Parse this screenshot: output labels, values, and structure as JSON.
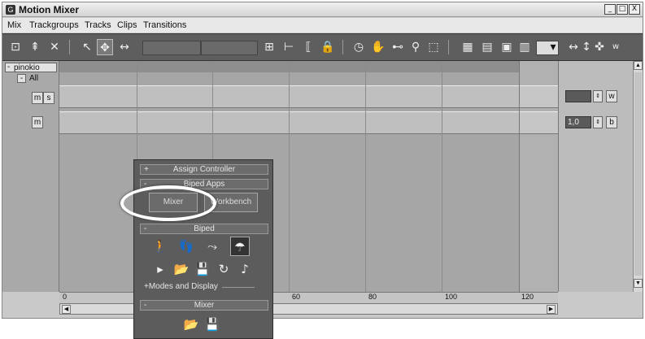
{
  "window": {
    "title": "Motion Mixer",
    "controls": [
      "_",
      "□",
      "X"
    ]
  },
  "menu": [
    "Mix",
    "Trackgroups",
    "Tracks",
    "Clips",
    "Transitions"
  ],
  "toolbar": {
    "icons": [
      "add-trackgroup-icon",
      "add-track-icon",
      "delete-icon",
      "select-icon",
      "move-icon",
      "slide-icon",
      "fit-icon",
      "timeline-icon",
      "bracket-icon",
      "lock-icon",
      "clock-icon",
      "pan-hand-icon",
      "zoom-extents-icon",
      "zoom-icon",
      "zoom-region-icon",
      "filter-icon",
      "filter2-icon",
      "mix-icon",
      "preview-icon",
      "dropdown-icon",
      "arrows-icon",
      "w-icon"
    ],
    "w_label": "w"
  },
  "tree": {
    "root": "pinokio",
    "group": "All",
    "track1_buttons": [
      "m",
      "s"
    ],
    "track2_buttons": [
      "m"
    ]
  },
  "right_controls": {
    "weight_label": "w",
    "value": "1,0",
    "b_label": "b"
  },
  "ruler": {
    "ticks": [
      "0",
      "60",
      "80",
      "100",
      "120"
    ]
  },
  "rollout": {
    "assign_controller": {
      "sign": "+",
      "label": "Assign Controller"
    },
    "biped_apps": {
      "sign": "-",
      "label": "Biped Apps",
      "mixer_button": "Mixer",
      "workbench_button": "Workbench"
    },
    "biped": {
      "sign": "-",
      "label": "Biped",
      "modes_display": "+Modes and Display"
    },
    "mixer": {
      "sign": "-",
      "label": "Mixer"
    }
  }
}
